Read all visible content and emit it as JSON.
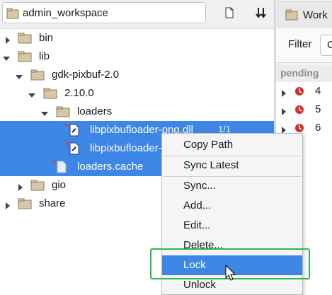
{
  "toolbar": {
    "workspace_name": "admin_workspace",
    "icons": [
      "workspace-icon",
      "new-file-icon",
      "sort-icon"
    ]
  },
  "tree": {
    "nodes": [
      {
        "label": "bin",
        "type": "folder",
        "expanded": false
      },
      {
        "label": "lib",
        "type": "folder",
        "expanded": true
      },
      {
        "label": "gdk-pixbuf-2.0",
        "type": "folder",
        "expanded": true
      },
      {
        "label": "2.10.0",
        "type": "folder",
        "expanded": true
      },
      {
        "label": "loaders",
        "type": "folder",
        "expanded": true
      },
      {
        "label": "libpixbufloader-png.dll",
        "rev": "1/1",
        "type": "file",
        "selected": true,
        "marker": "*"
      },
      {
        "label": "libpixbufloader-png.dll",
        "type": "file",
        "selected": true,
        "marker": "*"
      },
      {
        "label": "loaders.cache",
        "type": "file",
        "selected": true,
        "marker": "*"
      },
      {
        "label": "gio",
        "type": "folder",
        "expanded": false
      },
      {
        "label": "share",
        "type": "folder",
        "expanded": false
      }
    ]
  },
  "right_pane": {
    "tab_label": "Work",
    "filter_label": "Filter",
    "filter_button": "C",
    "pending_header": "pending",
    "changelists": [
      "4",
      "5",
      "6"
    ]
  },
  "context_menu": {
    "items": [
      {
        "label": "Copy Path"
      },
      {
        "label": "Sync Latest"
      },
      {
        "label": "Sync..."
      },
      {
        "label": "Add..."
      },
      {
        "label": "Edit..."
      },
      {
        "label": "Delete..."
      },
      {
        "label": "Lock",
        "highlighted": true
      },
      {
        "label": "Unlock"
      }
    ]
  },
  "colors": {
    "selection": "#3d86e6",
    "focus_outline": "#2eb84b",
    "pending_clock": "#d32f2f"
  }
}
